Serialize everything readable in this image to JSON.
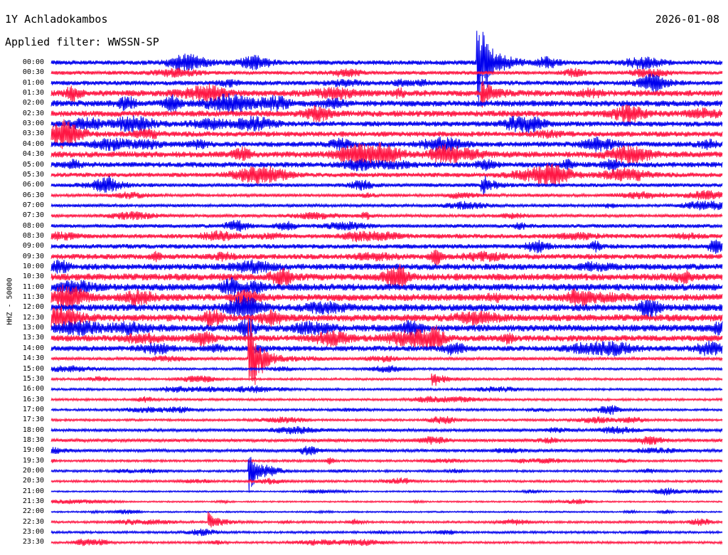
{
  "header": {
    "station": "1Y Achladokambos",
    "date": "2026-01-08",
    "filter": "Applied filter: WWSSN-SP"
  },
  "chart_data": {
    "type": "line",
    "title": "1Y Achladokambos",
    "ylabel": "HHZ - 50000",
    "series_colors": [
      "#0000ee",
      "#ff1744"
    ],
    "rows": [
      "00:00",
      "00:30",
      "01:00",
      "01:30",
      "02:00",
      "02:30",
      "03:00",
      "03:30",
      "04:00",
      "04:30",
      "05:00",
      "05:30",
      "06:00",
      "06:30",
      "07:00",
      "07:30",
      "08:00",
      "08:30",
      "09:00",
      "09:30",
      "10:00",
      "10:30",
      "11:00",
      "11:30",
      "12:00",
      "12:30",
      "13:00",
      "13:30",
      "14:00",
      "14:30",
      "15:00",
      "15:30",
      "16:00",
      "16:30",
      "17:00",
      "17:30",
      "18:00",
      "18:30",
      "19:00",
      "19:30",
      "20:00",
      "20:30",
      "21:00",
      "21:30",
      "22:00",
      "22:30",
      "23:00",
      "23:30"
    ],
    "row_labels": [
      "00:00",
      "00:30",
      "01:00",
      "01:30",
      "02:00",
      "02:30",
      "03:00",
      "03:30",
      "04:00",
      "04:30",
      "05:00",
      "05:30",
      "06:00",
      "06:30",
      "07:00",
      "07:30",
      "08:00",
      "08:30",
      "09:00",
      "09:30",
      "10:00",
      "10:30",
      "11:00",
      "11:30",
      "12:00",
      "12:30",
      "13:00",
      "13:30",
      "14:00",
      "14:30",
      "15:00",
      "15:30",
      "16:00",
      "16:30",
      "17:00",
      "17:30",
      "18:00",
      "18:30",
      "19:00",
      "19:30",
      "20:00",
      "20:30",
      "21:00",
      "21:30",
      "22:00",
      "22:30",
      "23:00",
      "23:30"
    ],
    "noise_level": [
      6,
      5,
      6,
      8,
      8,
      8,
      7,
      7,
      7,
      8,
      7,
      6,
      5,
      4,
      4,
      4,
      5,
      6,
      6,
      7,
      8,
      9,
      9,
      9,
      9,
      9,
      9,
      8,
      7,
      4,
      3,
      3,
      3,
      3,
      3,
      3,
      4,
      4,
      4,
      3,
      3,
      3,
      2,
      2,
      2,
      3,
      3,
      3
    ],
    "events": [
      {
        "row": "00:00",
        "minute": 19.0,
        "amplitude": 95,
        "direction": "up"
      },
      {
        "row": "01:30",
        "minute": 19.2,
        "amplitude": 25,
        "direction": "down"
      },
      {
        "row": "06:00",
        "minute": 19.2,
        "amplitude": 18,
        "direction": "down"
      },
      {
        "row": "14:30",
        "minute": 8.8,
        "amplitude": 85,
        "direction": "down"
      },
      {
        "row": "15:30",
        "minute": 17.0,
        "amplitude": 14,
        "direction": "down"
      },
      {
        "row": "20:00",
        "minute": 8.8,
        "amplitude": 40,
        "direction": "down"
      },
      {
        "row": "22:30",
        "minute": 7.0,
        "amplitude": 18,
        "direction": "down"
      }
    ]
  }
}
